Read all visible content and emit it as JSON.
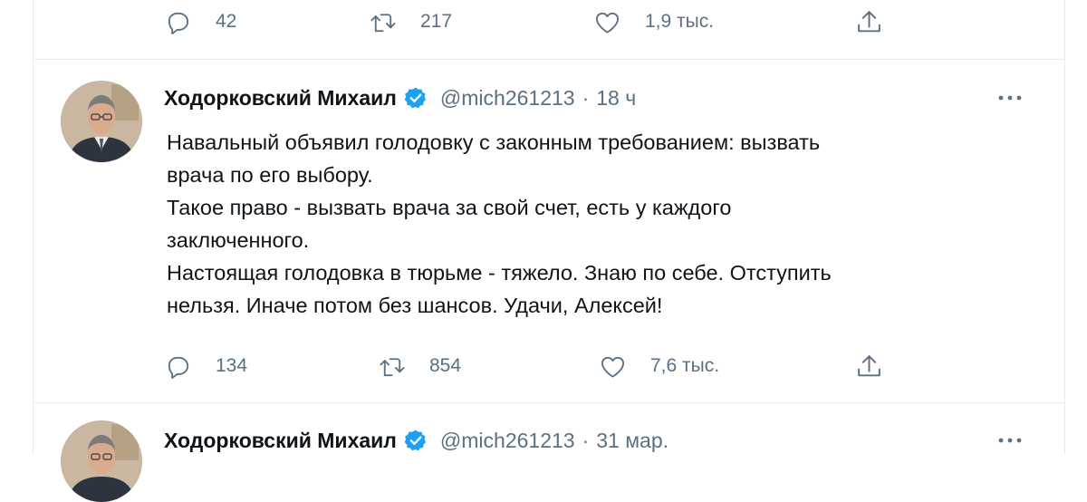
{
  "top_tweet": {
    "reply_count": "42",
    "retweet_count": "217",
    "like_count": "1,9 тыс."
  },
  "tweet": {
    "author_name": "Ходорковский Михаил",
    "handle": "@mich261213",
    "separator": "·",
    "time": "18 ч",
    "text_lines": [
      "Навальный объявил голодовку с законным требованием: вызвать",
      "врача по его выбору.",
      "Такое право - вызвать врача за свой счет, есть у каждого",
      "заключенного.",
      "Настоящая голодовка в тюрьме - тяжело. Знаю по себе. Отступить",
      "нельзя. Иначе потом без шансов. Удачи, Алексей!"
    ],
    "reply_count": "134",
    "retweet_count": "854",
    "like_count": "7,6 тыс."
  },
  "next_tweet": {
    "author_name": "Ходорковский Михаил",
    "handle": "@mich261213",
    "separator": "·",
    "time": "31 мар."
  },
  "icons": {
    "reply": "reply-icon",
    "retweet": "retweet-icon",
    "like": "heart-icon",
    "share": "share-icon",
    "more": "more-icon",
    "verified": "verified-badge-icon"
  },
  "colors": {
    "accent": "#1da1f2",
    "secondary_text": "#5b7083",
    "divider": "#e6ecf0"
  }
}
